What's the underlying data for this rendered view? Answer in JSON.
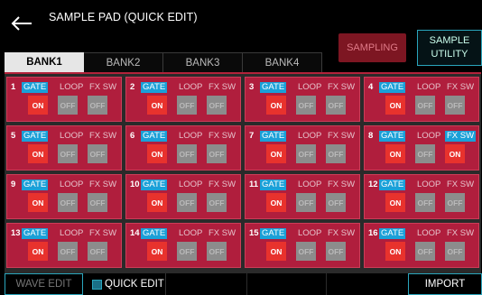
{
  "header": {
    "title": "SAMPLE PAD (QUICK EDIT)",
    "sampling_label": "SAMPLING",
    "utility_label_1": "SAMPLE",
    "utility_label_2": "UTILITY"
  },
  "tabs": [
    {
      "label": "BANK1",
      "active": true
    },
    {
      "label": "BANK2"
    },
    {
      "label": "BANK3"
    },
    {
      "label": "BANK4"
    }
  ],
  "pad_labels": {
    "gate": "GATE",
    "loop": "LOOP",
    "fxsw": "FX SW",
    "on": "ON",
    "off": "OFF"
  },
  "pads": [
    {
      "num": "1",
      "loop": false,
      "fxsw": false
    },
    {
      "num": "2",
      "loop": false,
      "fxsw": false
    },
    {
      "num": "3",
      "loop": false,
      "fxsw": false
    },
    {
      "num": "4",
      "loop": false,
      "fxsw": false
    },
    {
      "num": "5",
      "loop": false,
      "fxsw": false
    },
    {
      "num": "6",
      "loop": false,
      "fxsw": false
    },
    {
      "num": "7",
      "loop": false,
      "fxsw": false
    },
    {
      "num": "8",
      "loop": false,
      "fxsw": true
    },
    {
      "num": "9",
      "loop": false,
      "fxsw": false
    },
    {
      "num": "10",
      "loop": false,
      "fxsw": false
    },
    {
      "num": "11",
      "loop": false,
      "fxsw": false
    },
    {
      "num": "12",
      "loop": false,
      "fxsw": false
    },
    {
      "num": "13",
      "loop": false,
      "fxsw": false
    },
    {
      "num": "14",
      "loop": false,
      "fxsw": false
    },
    {
      "num": "15",
      "loop": false,
      "fxsw": false
    },
    {
      "num": "16",
      "loop": false,
      "fxsw": false
    }
  ],
  "footer": {
    "wave_edit": "WAVE EDIT",
    "quick_edit": "QUICK EDIT",
    "import": "IMPORT"
  },
  "colors": {
    "pad": "#b01e3d",
    "on": "#e8322d",
    "off": "#8c8c8c",
    "accent": "#1aa0d8"
  }
}
